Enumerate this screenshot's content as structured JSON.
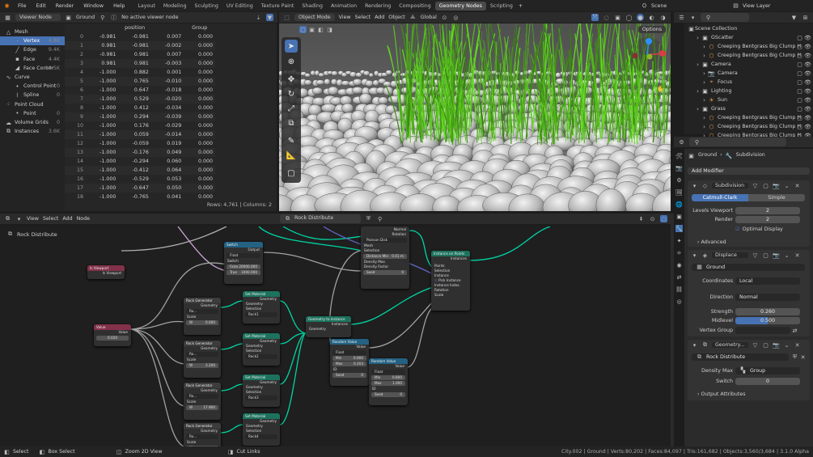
{
  "menu": {
    "file": "File",
    "edit": "Edit",
    "render": "Render",
    "window": "Window",
    "help": "Help"
  },
  "workspaces": [
    "Layout",
    "Modeling",
    "Sculpting",
    "UV Editing",
    "Texture Paint",
    "Shading",
    "Animation",
    "Rendering",
    "Compositing",
    "Geometry Nodes",
    "Scripting"
  ],
  "active_workspace": "Geometry Nodes",
  "add_tab": "+",
  "scene": "Scene",
  "view_layer": "View Layer",
  "spreadsheet": {
    "editor": "Viewer Node",
    "object": "Ground",
    "viewer_status": "No active viewer node",
    "domains": [
      {
        "label": "Mesh",
        "count": ""
      },
      {
        "label": "Vertex",
        "count": "4.8K"
      },
      {
        "label": "Edge",
        "count": "9.4K"
      },
      {
        "label": "Face",
        "count": "4.4K"
      },
      {
        "label": "Face Corner",
        "count": "18.5K"
      },
      {
        "label": "Curve",
        "count": ""
      },
      {
        "label": "Control Point",
        "count": "0"
      },
      {
        "label": "Spline",
        "count": "0"
      },
      {
        "label": "Point Cloud",
        "count": ""
      },
      {
        "label": "Point",
        "count": "0"
      },
      {
        "label": "Volume Grids",
        "count": "0"
      },
      {
        "label": "Instances",
        "count": "3.6K"
      }
    ],
    "col_position": "position",
    "col_group": "Group",
    "rows": [
      [
        "0",
        "-0.981",
        "-0.981",
        "0.007",
        "0.000"
      ],
      [
        "1",
        "0.981",
        "-0.981",
        "-0.002",
        "0.000"
      ],
      [
        "2",
        "-0.981",
        "0.981",
        "0.007",
        "0.000"
      ],
      [
        "3",
        "0.981",
        "0.981",
        "-0.003",
        "0.000"
      ],
      [
        "4",
        "-1.000",
        "0.882",
        "0.001",
        "0.000"
      ],
      [
        "5",
        "-1.000",
        "0.765",
        "-0.010",
        "0.000"
      ],
      [
        "6",
        "-1.000",
        "0.647",
        "-0.018",
        "0.000"
      ],
      [
        "7",
        "-1.000",
        "0.529",
        "-0.020",
        "0.000"
      ],
      [
        "8",
        "-1.000",
        "0.412",
        "-0.034",
        "0.000"
      ],
      [
        "9",
        "-1.000",
        "0.294",
        "-0.039",
        "0.000"
      ],
      [
        "10",
        "-1.000",
        "0.176",
        "-0.029",
        "0.000"
      ],
      [
        "11",
        "-1.000",
        "0.059",
        "-0.014",
        "0.000"
      ],
      [
        "12",
        "-1.000",
        "-0.059",
        "0.019",
        "0.000"
      ],
      [
        "13",
        "-1.000",
        "-0.176",
        "0.049",
        "0.000"
      ],
      [
        "14",
        "-1.000",
        "-0.294",
        "0.060",
        "0.000"
      ],
      [
        "15",
        "-1.000",
        "-0.412",
        "0.064",
        "0.000"
      ],
      [
        "16",
        "-1.000",
        "-0.529",
        "0.053",
        "0.000"
      ],
      [
        "17",
        "-1.000",
        "-0.647",
        "0.050",
        "0.000"
      ],
      [
        "18",
        "-1.000",
        "-0.765",
        "0.041",
        "0.000"
      ]
    ],
    "footer": "Rows: 4,761   |   Columns: 2"
  },
  "viewport": {
    "mode": "Object Mode",
    "view": "View",
    "select": "Select",
    "add": "Add",
    "object": "Object",
    "orientation": "Global",
    "options": "Options"
  },
  "node_editor": {
    "view": "View",
    "select": "Select",
    "add": "Add",
    "node": "Node",
    "tree": "Rock Distribute",
    "breadcrumb": "Rock Distribute",
    "nodes": {
      "is_viewport": {
        "title": "Is Viewport",
        "out": "Is Viewport"
      },
      "value": {
        "title": "Value",
        "out": "Value",
        "val": "0.020"
      },
      "switch": {
        "title": "Switch",
        "out": "Output",
        "type": "Float",
        "sw": "Switch",
        "false_l": "False",
        "false_v": "20000.000",
        "true_l": "True",
        "true_v": "1000.000"
      },
      "distribute": {
        "type": "Poisson Disk",
        "normal": "Normal",
        "rotation": "Rotation",
        "mesh": "Mesh",
        "selection": "Selection",
        "dist": "Distance Min",
        "dist_v": "0.01 m",
        "dmax": "Density Max",
        "dfac": "Density Factor",
        "seed": "Seed",
        "seed_v": "0"
      },
      "iop": {
        "title": "Instance on Points",
        "out": "Instances",
        "points": "Points",
        "selection": "Selection",
        "instance": "Instance",
        "pick": "Pick Instance",
        "index": "Instance Index",
        "rotation": "Rotation",
        "scale": "Scale"
      },
      "gti": {
        "title": "Geometry to Instance",
        "out": "Instances",
        "geo": "Geometry"
      },
      "rg": [
        {
          "title": "Rock Generator",
          "geo": "Geometry",
          "sel": "Ro...",
          "scale": "Scale",
          "w_l": "W",
          "w": "0.000"
        },
        {
          "title": "Rock Generator",
          "geo": "Geometry",
          "sel": "Ro...",
          "scale": "Scale",
          "w_l": "W",
          "w": "3.200"
        },
        {
          "title": "Rock Generator",
          "geo": "Geometry",
          "sel": "Ro...",
          "scale": "Scale",
          "w_l": "W",
          "w": "17.900"
        },
        {
          "title": "Rock Generator",
          "geo": "Geometry",
          "sel": "Ro...",
          "scale": "Scale",
          "w_l": "W",
          "w": ""
        }
      ],
      "sm": [
        {
          "title": "Set Material",
          "geo": "Geometry",
          "sel": "Selection",
          "mat": "Rock1"
        },
        {
          "title": "Set Material",
          "geo": "Geometry",
          "sel": "Selection",
          "mat": "Rock2"
        },
        {
          "title": "Set Material",
          "geo": "Geometry",
          "sel": "Selection",
          "mat": "Rock3"
        },
        {
          "title": "Set Material",
          "geo": "Geometry",
          "sel": "Selection",
          "mat": "Rock4"
        }
      ],
      "rv1": {
        "title": "Random Value",
        "out": "Value",
        "type": "Float",
        "min_l": "Min",
        "min": "0.000",
        "max_l": "Max",
        "max": "0.203",
        "id": "ID",
        "seed_l": "Seed",
        "seed": "0"
      },
      "rv2": {
        "title": "Random Value",
        "out": "Value",
        "type": "Float",
        "min_l": "Min",
        "min": "0.800",
        "max_l": "Max",
        "max": "1.000",
        "id": "ID",
        "seed_l": "Seed",
        "seed": "0"
      }
    }
  },
  "outliner": {
    "title": "Scene Collection",
    "items": [
      {
        "label": "GScatter",
        "indent": 1
      },
      {
        "label": "Creeping Bentgrass Big Clump H",
        "indent": 2
      },
      {
        "label": "Creeping Bentgrass Big Clump H",
        "indent": 2
      },
      {
        "label": "Camera",
        "indent": 1
      },
      {
        "label": "Camera",
        "indent": 2
      },
      {
        "label": "Focus",
        "indent": 2
      },
      {
        "label": "Lighting",
        "indent": 1
      },
      {
        "label": "Sun",
        "indent": 2
      },
      {
        "label": "Grass",
        "indent": 1
      },
      {
        "label": "Creeping Bentgrass Big Clump H",
        "indent": 2
      },
      {
        "label": "Creeping Bentgrass Big Clump H",
        "indent": 2
      },
      {
        "label": "Creeping Bentgrass Big Clump H",
        "indent": 2
      }
    ]
  },
  "properties": {
    "object": "Ground",
    "modifier_crumb": "Subdivision",
    "add_modifier": "Add Modifier",
    "subdiv": {
      "name": "Subdivision",
      "catmull": "Catmull-Clark",
      "simple": "Simple",
      "levels_label": "Levels Viewport",
      "levels": "2",
      "render_label": "Render",
      "render": "2",
      "optimal": "Optimal Display",
      "advanced": "Advanced"
    },
    "displace": {
      "name": "Displace",
      "texture": "Ground",
      "coords_label": "Coordinates",
      "coords": "Local",
      "dir_label": "Direction",
      "dir": "Normal",
      "strength_label": "Strength",
      "strength": "0.260",
      "midlevel_label": "Midlevel",
      "midlevel": "0.500",
      "vgroup_label": "Vertex Group"
    },
    "geonodes": {
      "name": "Geometry...",
      "tree": "Rock Distribute",
      "dmax_label": "Density Max",
      "dmax": "Group",
      "switch_label": "Switch",
      "switch": "0",
      "outattr": "Output Attributes"
    }
  },
  "status": {
    "select": "Select",
    "box_select": "Box Select",
    "zoom": "Zoom 2D View",
    "cut": "Cut Links",
    "info": "City.002 | Ground | Verts:80,202 | Faces:84,097 | Tris:161,682 | Objects:3,560/3,684 | 3.1.0 Alpha"
  },
  "colors": {
    "accent": "#4772b3",
    "geo_link": "#00d6a3",
    "float_link": "#a1a1a1",
    "vector_link": "#6363c7",
    "bool_link": "#cca6d6",
    "node_geo_header": "#1d725e",
    "node_input_header": "#83314a",
    "node_convert_header": "#246283"
  }
}
